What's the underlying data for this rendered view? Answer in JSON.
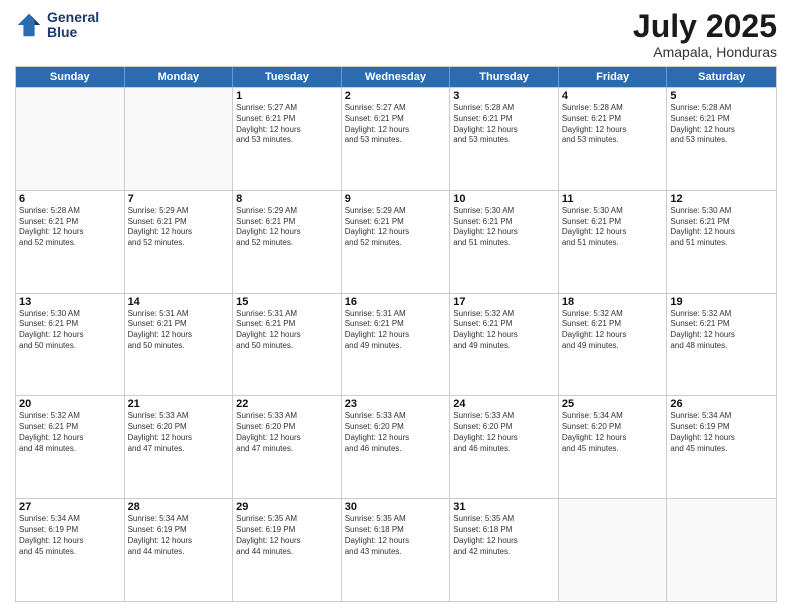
{
  "header": {
    "logo_line1": "General",
    "logo_line2": "Blue",
    "month": "July 2025",
    "location": "Amapala, Honduras"
  },
  "days_of_week": [
    "Sunday",
    "Monday",
    "Tuesday",
    "Wednesday",
    "Thursday",
    "Friday",
    "Saturday"
  ],
  "weeks": [
    [
      {
        "day": "",
        "info": ""
      },
      {
        "day": "",
        "info": ""
      },
      {
        "day": "1",
        "info": "Sunrise: 5:27 AM\nSunset: 6:21 PM\nDaylight: 12 hours\nand 53 minutes."
      },
      {
        "day": "2",
        "info": "Sunrise: 5:27 AM\nSunset: 6:21 PM\nDaylight: 12 hours\nand 53 minutes."
      },
      {
        "day": "3",
        "info": "Sunrise: 5:28 AM\nSunset: 6:21 PM\nDaylight: 12 hours\nand 53 minutes."
      },
      {
        "day": "4",
        "info": "Sunrise: 5:28 AM\nSunset: 6:21 PM\nDaylight: 12 hours\nand 53 minutes."
      },
      {
        "day": "5",
        "info": "Sunrise: 5:28 AM\nSunset: 6:21 PM\nDaylight: 12 hours\nand 53 minutes."
      }
    ],
    [
      {
        "day": "6",
        "info": "Sunrise: 5:28 AM\nSunset: 6:21 PM\nDaylight: 12 hours\nand 52 minutes."
      },
      {
        "day": "7",
        "info": "Sunrise: 5:29 AM\nSunset: 6:21 PM\nDaylight: 12 hours\nand 52 minutes."
      },
      {
        "day": "8",
        "info": "Sunrise: 5:29 AM\nSunset: 6:21 PM\nDaylight: 12 hours\nand 52 minutes."
      },
      {
        "day": "9",
        "info": "Sunrise: 5:29 AM\nSunset: 6:21 PM\nDaylight: 12 hours\nand 52 minutes."
      },
      {
        "day": "10",
        "info": "Sunrise: 5:30 AM\nSunset: 6:21 PM\nDaylight: 12 hours\nand 51 minutes."
      },
      {
        "day": "11",
        "info": "Sunrise: 5:30 AM\nSunset: 6:21 PM\nDaylight: 12 hours\nand 51 minutes."
      },
      {
        "day": "12",
        "info": "Sunrise: 5:30 AM\nSunset: 6:21 PM\nDaylight: 12 hours\nand 51 minutes."
      }
    ],
    [
      {
        "day": "13",
        "info": "Sunrise: 5:30 AM\nSunset: 6:21 PM\nDaylight: 12 hours\nand 50 minutes."
      },
      {
        "day": "14",
        "info": "Sunrise: 5:31 AM\nSunset: 6:21 PM\nDaylight: 12 hours\nand 50 minutes."
      },
      {
        "day": "15",
        "info": "Sunrise: 5:31 AM\nSunset: 6:21 PM\nDaylight: 12 hours\nand 50 minutes."
      },
      {
        "day": "16",
        "info": "Sunrise: 5:31 AM\nSunset: 6:21 PM\nDaylight: 12 hours\nand 49 minutes."
      },
      {
        "day": "17",
        "info": "Sunrise: 5:32 AM\nSunset: 6:21 PM\nDaylight: 12 hours\nand 49 minutes."
      },
      {
        "day": "18",
        "info": "Sunrise: 5:32 AM\nSunset: 6:21 PM\nDaylight: 12 hours\nand 49 minutes."
      },
      {
        "day": "19",
        "info": "Sunrise: 5:32 AM\nSunset: 6:21 PM\nDaylight: 12 hours\nand 48 minutes."
      }
    ],
    [
      {
        "day": "20",
        "info": "Sunrise: 5:32 AM\nSunset: 6:21 PM\nDaylight: 12 hours\nand 48 minutes."
      },
      {
        "day": "21",
        "info": "Sunrise: 5:33 AM\nSunset: 6:20 PM\nDaylight: 12 hours\nand 47 minutes."
      },
      {
        "day": "22",
        "info": "Sunrise: 5:33 AM\nSunset: 6:20 PM\nDaylight: 12 hours\nand 47 minutes."
      },
      {
        "day": "23",
        "info": "Sunrise: 5:33 AM\nSunset: 6:20 PM\nDaylight: 12 hours\nand 46 minutes."
      },
      {
        "day": "24",
        "info": "Sunrise: 5:33 AM\nSunset: 6:20 PM\nDaylight: 12 hours\nand 46 minutes."
      },
      {
        "day": "25",
        "info": "Sunrise: 5:34 AM\nSunset: 6:20 PM\nDaylight: 12 hours\nand 45 minutes."
      },
      {
        "day": "26",
        "info": "Sunrise: 5:34 AM\nSunset: 6:19 PM\nDaylight: 12 hours\nand 45 minutes."
      }
    ],
    [
      {
        "day": "27",
        "info": "Sunrise: 5:34 AM\nSunset: 6:19 PM\nDaylight: 12 hours\nand 45 minutes."
      },
      {
        "day": "28",
        "info": "Sunrise: 5:34 AM\nSunset: 6:19 PM\nDaylight: 12 hours\nand 44 minutes."
      },
      {
        "day": "29",
        "info": "Sunrise: 5:35 AM\nSunset: 6:19 PM\nDaylight: 12 hours\nand 44 minutes."
      },
      {
        "day": "30",
        "info": "Sunrise: 5:35 AM\nSunset: 6:18 PM\nDaylight: 12 hours\nand 43 minutes."
      },
      {
        "day": "31",
        "info": "Sunrise: 5:35 AM\nSunset: 6:18 PM\nDaylight: 12 hours\nand 42 minutes."
      },
      {
        "day": "",
        "info": ""
      },
      {
        "day": "",
        "info": ""
      }
    ]
  ]
}
